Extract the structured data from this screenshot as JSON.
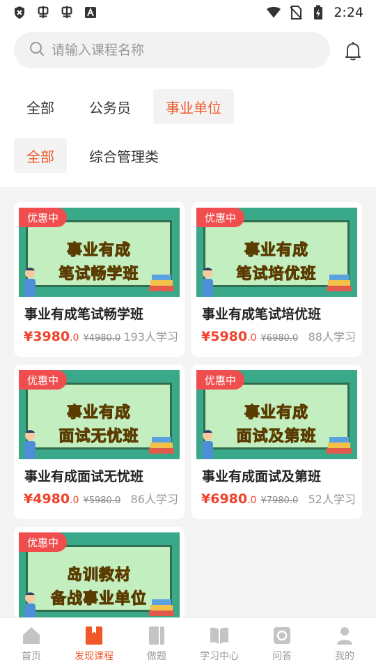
{
  "status_bar": {
    "time": "2:24",
    "icons": [
      "shield-icon",
      "app-icon",
      "app-icon",
      "text-icon",
      "wifi-icon",
      "no-sim-icon",
      "battery-icon"
    ]
  },
  "search": {
    "placeholder": "请输入课程名称"
  },
  "categories": [
    "全部",
    "公务员",
    "事业单位"
  ],
  "subcategories": [
    "全部",
    "综合管理类"
  ],
  "courses": [
    {
      "badge": "优惠中",
      "poster_line1": "事业有成",
      "poster_line2": "笔试畅学班",
      "title": "事业有成笔试畅学班",
      "price": "¥3980",
      "price_decimal": ".0",
      "old_price": "¥4980.0",
      "learners": "193人学习"
    },
    {
      "badge": "优惠中",
      "poster_line1": "事业有成",
      "poster_line2": "笔试培优班",
      "title": "事业有成笔试培优班",
      "price": "¥5980",
      "price_decimal": ".0",
      "old_price": "¥6980.0",
      "learners": "88人学习"
    },
    {
      "badge": "优惠中",
      "poster_line1": "事业有成",
      "poster_line2": "面试无忧班",
      "title": "事业有成面试无忧班",
      "price": "¥4980",
      "price_decimal": ".0",
      "old_price": "¥5980.0",
      "learners": "86人学习"
    },
    {
      "badge": "优惠中",
      "poster_line1": "事业有成",
      "poster_line2": "面试及第班",
      "title": "事业有成面试及第班",
      "price": "¥6980",
      "price_decimal": ".0",
      "old_price": "¥7980.0",
      "learners": "52人学习"
    },
    {
      "badge": "优惠中",
      "poster_line1": "岛训教材",
      "poster_line2": "备战事业单位"
    }
  ],
  "nav": [
    {
      "label": "首页",
      "icon": "home-icon"
    },
    {
      "label": "发现课程",
      "icon": "bookmark-book-icon"
    },
    {
      "label": "做题",
      "icon": "practice-icon"
    },
    {
      "label": "学习中心",
      "icon": "open-book-icon"
    },
    {
      "label": "问答",
      "icon": "qa-icon"
    },
    {
      "label": "我的",
      "icon": "profile-icon"
    }
  ],
  "colors": {
    "accent": "#f0582a",
    "price": "#f0422c",
    "badge": "#f04e4e"
  }
}
